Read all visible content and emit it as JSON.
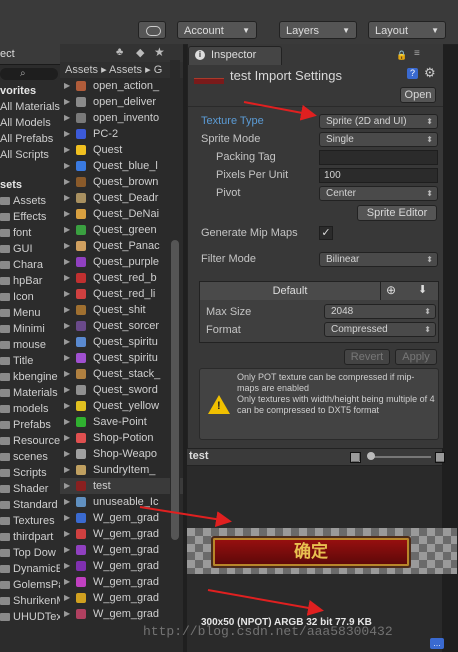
{
  "toolbar": {
    "account_label": "Account",
    "layers_label": "Layers",
    "layout_label": "Layout"
  },
  "project_tab": {
    "label": "ect"
  },
  "favorites": {
    "header": "vorites",
    "items": [
      "All Materials",
      "All Models",
      "All Prefabs",
      "All Scripts"
    ]
  },
  "assets_tree": {
    "header": "sets",
    "items": [
      "Assets",
      "Effects",
      "font",
      "GUI",
      "Chara",
      "hpBar",
      "Icon",
      "Menu",
      "Minimi",
      "mouse",
      "Title",
      "kbengine",
      "Materials",
      "models",
      "Prefabs",
      "Resources",
      "scenes",
      "Scripts",
      "Shader",
      "Standard",
      "Textures",
      "thirdpart",
      "Top Dow",
      "DynamicEl",
      "GolemsPac",
      "ShurikenM",
      "UHUDText"
    ]
  },
  "breadcrumb": {
    "part1": "Assets",
    "part2": "Assets",
    "part3": "G"
  },
  "asset_list": [
    {
      "label": "open_action_",
      "color": "#b05c3a"
    },
    {
      "label": "open_deliver",
      "color": "#8a8a8a"
    },
    {
      "label": "open_invento",
      "color": "#7a7a7a"
    },
    {
      "label": "PC-2",
      "color": "#3c5ad8"
    },
    {
      "label": "Quest",
      "color": "#f0c020"
    },
    {
      "label": "Quest_blue_l",
      "color": "#3a7ae0"
    },
    {
      "label": "Quest_brown",
      "color": "#8a5a2a"
    },
    {
      "label": "Quest_Deadr",
      "color": "#a89060"
    },
    {
      "label": "Quest_DeNai",
      "color": "#d8a040"
    },
    {
      "label": "Quest_green",
      "color": "#3aa040"
    },
    {
      "label": "Quest_Panac",
      "color": "#d0a060"
    },
    {
      "label": "Quest_purple",
      "color": "#9040c0"
    },
    {
      "label": "Quest_red_b",
      "color": "#c03030"
    },
    {
      "label": "Quest_red_li",
      "color": "#d04040"
    },
    {
      "label": "Quest_shit",
      "color": "#a07030"
    },
    {
      "label": "Quest_sorcer",
      "color": "#6a4a8a"
    },
    {
      "label": "Quest_spiritu",
      "color": "#5a8ad0"
    },
    {
      "label": "Quest_spiritu",
      "color": "#a050d0"
    },
    {
      "label": "Quest_stack_",
      "color": "#b08040"
    },
    {
      "label": "Quest_sword",
      "color": "#909090"
    },
    {
      "label": "Quest_yellow",
      "color": "#e0c020"
    },
    {
      "label": "Save-Point",
      "color": "#30b030"
    },
    {
      "label": "Shop-Potion",
      "color": "#e05050"
    },
    {
      "label": "Shop-Weapo",
      "color": "#a0a0a0"
    },
    {
      "label": "SundryItem_",
      "color": "#c0a060"
    },
    {
      "label": "test",
      "color": "#8a2020"
    },
    {
      "label": "unuseable_Ic",
      "color": "#6090c0"
    },
    {
      "label": "W_gem_grad",
      "color": "#3a6ad0"
    },
    {
      "label": "W_gem_grad",
      "color": "#d04040"
    },
    {
      "label": "W_gem_grad",
      "color": "#9040c0"
    },
    {
      "label": "W_gem_grad",
      "color": "#8030b0"
    },
    {
      "label": "W_gem_grad",
      "color": "#c040c0"
    },
    {
      "label": "W_gem_grad",
      "color": "#d0a020"
    },
    {
      "label": "W_gem_grad",
      "color": "#b04060"
    }
  ],
  "inspector": {
    "tab_label": "Inspector",
    "title": "test Import Settings",
    "open_button": "Open",
    "texture_type_label": "Texture Type",
    "texture_type_value": "Sprite (2D and UI)",
    "sprite_mode_label": "Sprite Mode",
    "sprite_mode_value": "Single",
    "packing_tag_label": "Packing Tag",
    "packing_tag_value": "",
    "ppu_label": "Pixels Per Unit",
    "ppu_value": "100",
    "pivot_label": "Pivot",
    "pivot_value": "Center",
    "sprite_editor_button": "Sprite Editor",
    "mipmaps_label": "Generate Mip Maps",
    "mipmaps_checked": true,
    "filter_mode_label": "Filter Mode",
    "filter_mode_value": "Bilinear",
    "platform_tab": "Default",
    "max_size_label": "Max Size",
    "max_size_value": "2048",
    "format_label": "Format",
    "format_value": "Compressed",
    "revert_button": "Revert",
    "apply_button": "Apply",
    "warning_text": "Only POT texture can be compressed if mip-maps are enabled\nOnly textures with width/height being multiple of 4 can be compressed to DXT5 format"
  },
  "preview": {
    "title": "test",
    "sprite_text": "确定",
    "info": "300x50 (NPOT)  ARGB 32 bit   77.9 KB",
    "watermark": "http://blog.csdn.net/aaa58300432"
  },
  "colors": {
    "accent_blue": "#5b9bd5",
    "arrow_red": "#e02020"
  }
}
